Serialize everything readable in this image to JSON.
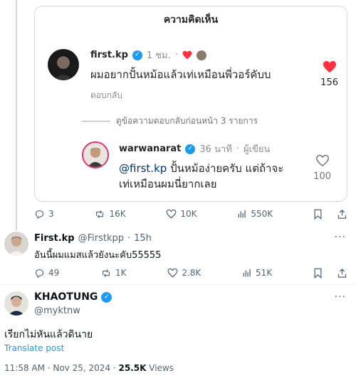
{
  "card": {
    "title": "ความคิดเห็น",
    "comment": {
      "username": "first.kp",
      "time": "1 ชม.",
      "text": "ผมอยากปั้นหม้อแล้วเท่เหมือนพี่วอร์คับบ",
      "reply_label": "ตอบกลับ",
      "like_count": "156"
    },
    "view_replies": "ดูข้อความตอบกลับก่อนหน้า 3 รายการ",
    "reply": {
      "username": "warwanarat",
      "time": "36 นาที",
      "author_label": "ผู้เขียน",
      "mention": "@first.kp",
      "text_line1": " ปั้นหม้อง่ายครับ แต่ถ้าจะ",
      "text_line2": "เท่เหมือนผมนี่ยากเลย",
      "like_count": "100"
    }
  },
  "post_actions": {
    "replies": "3",
    "reposts": "16K",
    "likes": "10K",
    "views": "550K"
  },
  "reply_tweet": {
    "name": "First.kp",
    "handle": "@Firstkpp",
    "time": "15h",
    "text": "อันนี้ผมแมสแล้วยังนะคับ55555",
    "replies": "49",
    "reposts": "1K",
    "likes": "2.8K",
    "views": "51K"
  },
  "main_tweet": {
    "name": "KHAOTUNG",
    "handle": "@myktnw",
    "text": "เรียกไม่หันแล้วดินาย",
    "translate": "Translate post",
    "time": "11:58 AM · Nov 25, 2024 · ",
    "views_count": "25.5K",
    "views_label": " Views"
  },
  "colors": {
    "accent": "#1d9bf0",
    "heart": "#ff3040",
    "text": "#0f1419",
    "muted": "#536471"
  }
}
